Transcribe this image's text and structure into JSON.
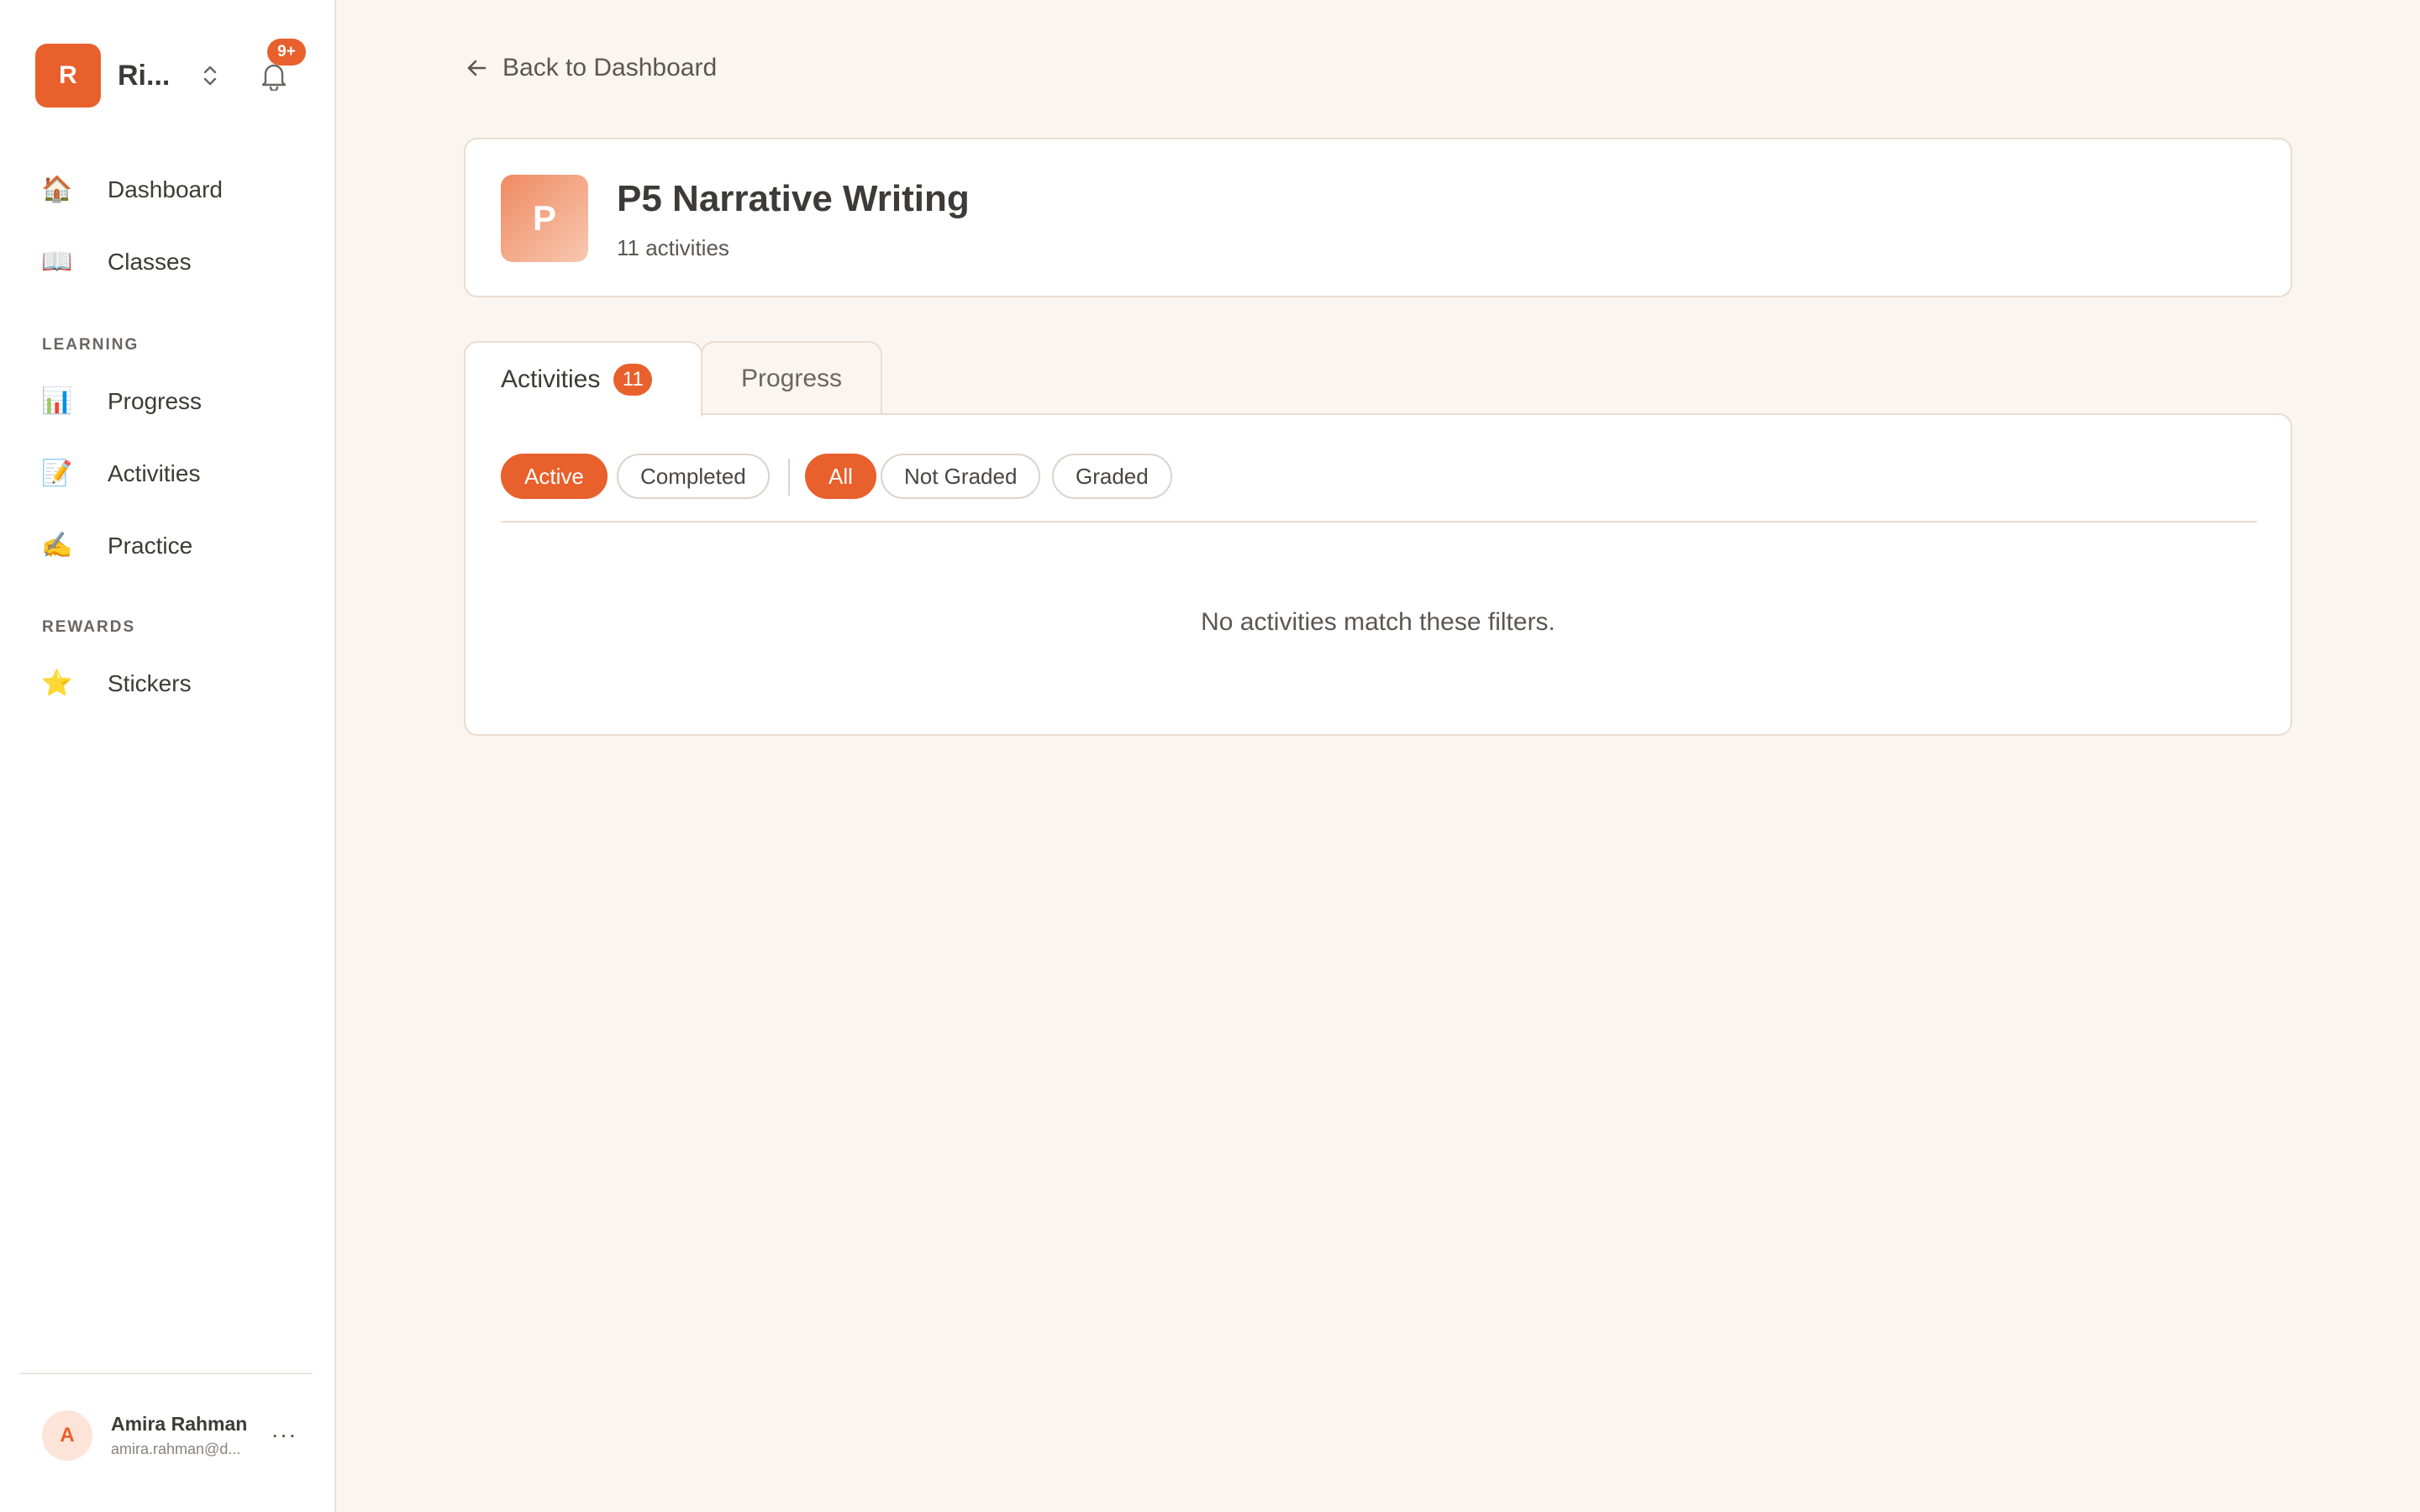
{
  "org": {
    "initial": "R",
    "name": "Ri...",
    "notification_count": "9+"
  },
  "nav": {
    "dashboard": {
      "label": "Dashboard",
      "emoji": "🏠"
    },
    "classes": {
      "label": "Classes",
      "emoji": "📖"
    },
    "section_learning": "LEARNING",
    "progress": {
      "label": "Progress",
      "emoji": "📊"
    },
    "activities": {
      "label": "Activities",
      "emoji": "📝"
    },
    "practice": {
      "label": "Practice",
      "emoji": "✍️"
    },
    "section_rewards": "REWARDS",
    "stickers": {
      "label": "Stickers",
      "emoji": "⭐"
    }
  },
  "user": {
    "initial": "A",
    "name": "Amira Rahman",
    "email": "amira.rahman@d...",
    "more": "···"
  },
  "back": {
    "label": "Back to Dashboard"
  },
  "class": {
    "initial": "P",
    "title": "P5 Narrative Writing",
    "subtitle": "11 activities"
  },
  "tabs": {
    "activities": {
      "label": "Activities",
      "count": "11"
    },
    "progress": {
      "label": "Progress"
    }
  },
  "filters": {
    "status": {
      "active": "Active",
      "completed": "Completed"
    },
    "grading": {
      "all": "All",
      "not_graded": "Not Graded",
      "graded": "Graded"
    }
  },
  "empty_message": "No activities match these filters.",
  "colors": {
    "accent": "#e8602c",
    "background": "#faf5f0",
    "border": "#ecdcd0"
  }
}
